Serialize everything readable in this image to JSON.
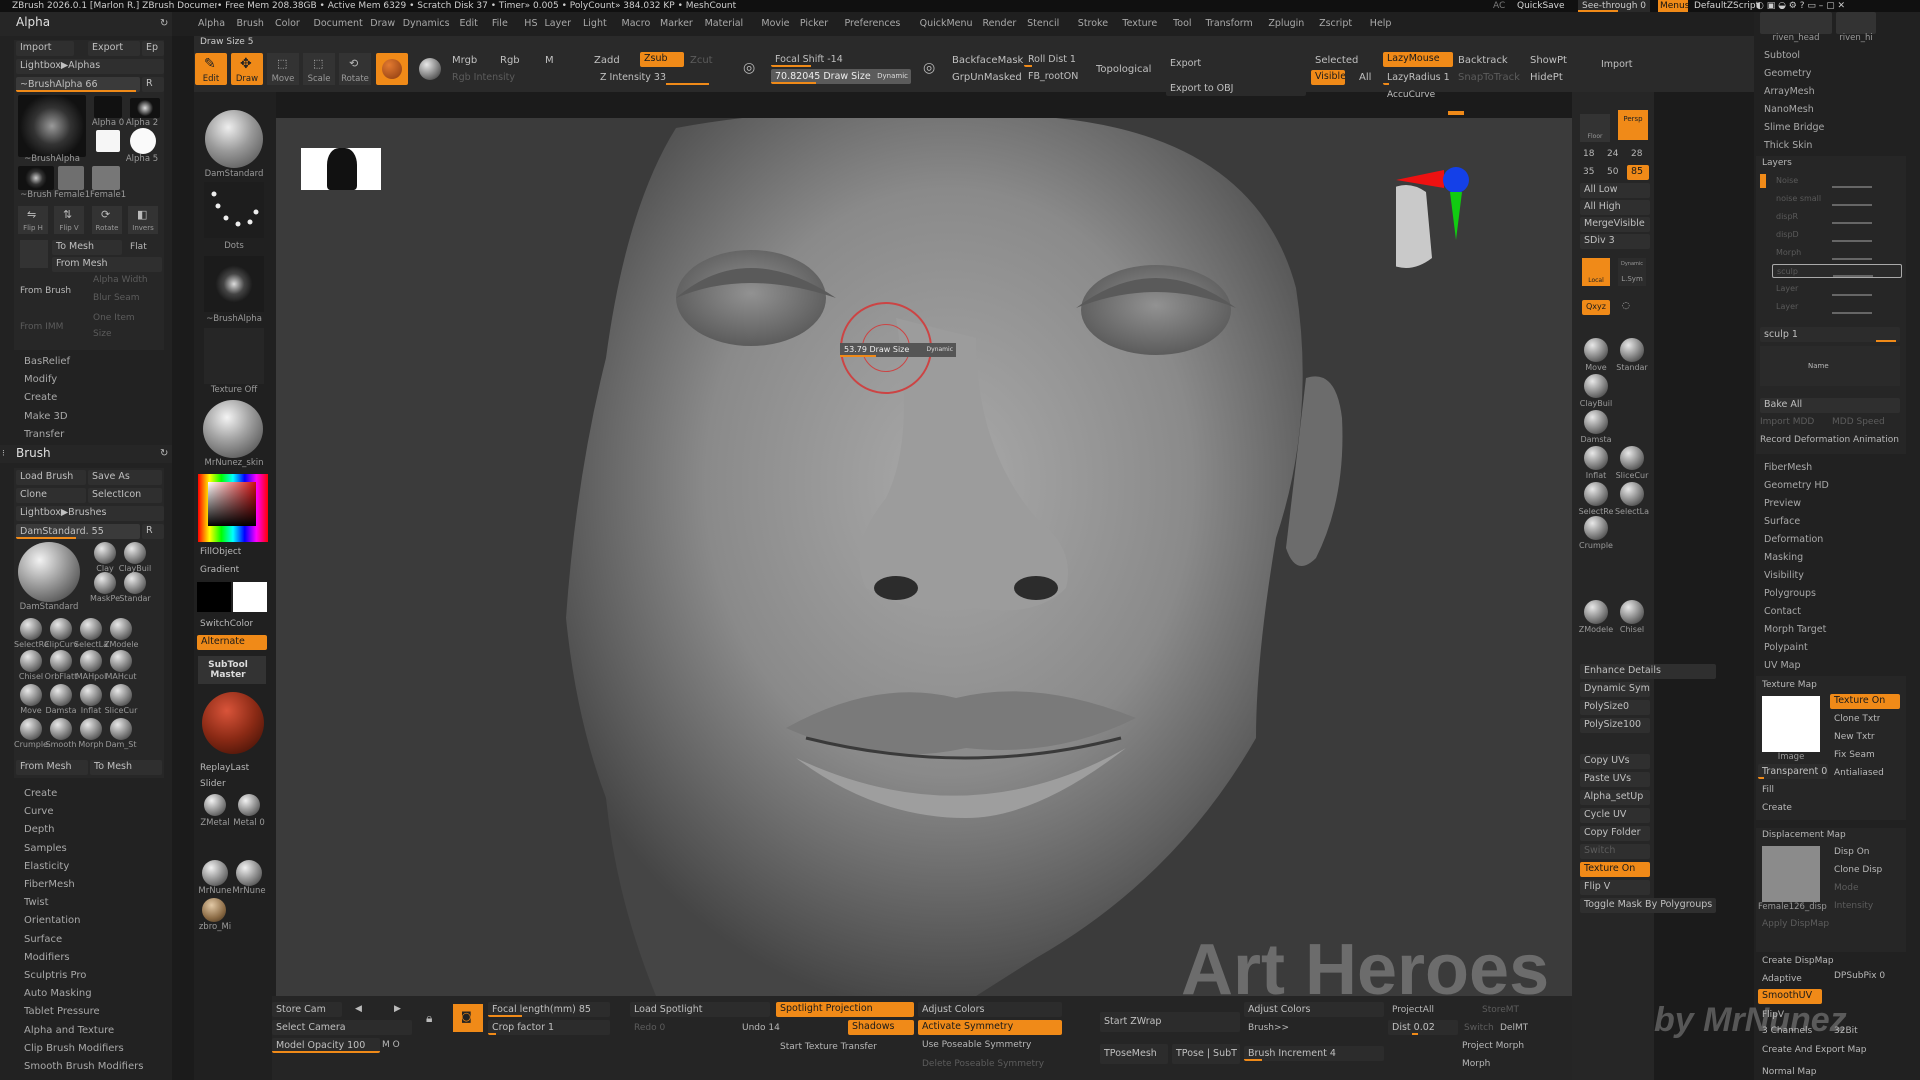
{
  "title_bar": {
    "app": "ZBrush 2026.0.1 [Marlon R.]  ZBrush Document",
    "stats": "• Free Mem 208.38GB • Active Mem 6329 • Scratch Disk 37 • Timer» 0.005 • PolyCount» 384.032 KP • MeshCount» 1",
    "ac": "AC",
    "quicksave": "QuickSave",
    "seethrough": "See-through  0",
    "menus": "Menus",
    "script": "DefaultZScript"
  },
  "menu_bar": [
    "Alpha",
    "Brush",
    "Color",
    "Document",
    "Draw",
    "Dynamics",
    "Edit",
    "File",
    "HS",
    "Layer",
    "Light",
    "Macro",
    "Marker",
    "Material",
    "Movie",
    "Picker",
    "Preferences",
    "QuickMenu",
    "Render",
    "Stencil",
    "Stroke",
    "Texture",
    "Tool",
    "Transform",
    "Zplugin",
    "Zscript",
    "Help"
  ],
  "shelf": {
    "draw_size_label": "Draw Size 5",
    "edit": "Edit",
    "draw": "Draw",
    "move": "Move",
    "scale": "Scale",
    "rotate": "Rotate",
    "mrgb": "Mrgb",
    "rgb": "Rgb",
    "m": "M",
    "rgb_intensity": "Rgb Intensity",
    "zadd": "Zadd",
    "zsub": "Zsub",
    "zcut": "Zcut",
    "z_intensity": "Z Intensity 33",
    "focal_shift": "Focal Shift -14",
    "draw_size": "70.82045 Draw Size",
    "dynamic": "Dynamic",
    "backface": "BackfaceMask",
    "grpunmasked": "GrpUnMasked",
    "rolldist": "Roll Dist 1",
    "fbroot": "FB_rootON",
    "topological": "Topological",
    "export": "Export",
    "export_obj": "Export to OBJ",
    "selected": "Selected",
    "visible": "Visible",
    "all": "All",
    "lazymouse": "LazyMouse",
    "lazyradius": "LazyRadius 1",
    "accucurve": "AccuCurve",
    "backtrack": "Backtrack",
    "snaptotrack": "SnapToTrack",
    "showpt": "ShowPt",
    "hidept": "HidePt",
    "import": "Import"
  },
  "left_tray": {
    "alpha_header": "Alpha",
    "import": "Import",
    "export": "Export",
    "ep": "Ep",
    "lightbox_alphas": "Lightbox▶Alphas",
    "brushalpha_slider": "~BrushAlpha  66",
    "r": "R",
    "alpha_names": [
      "~BrushAlpha",
      "Alpha 0",
      "Alpha 2",
      "Alpha 5",
      "~Brush",
      "Female1",
      "Female1"
    ],
    "flipH": "Flip H",
    "flipV": "Flip V",
    "rotate": "Rotate",
    "invers": "Invers",
    "to_mesh": "To Mesh",
    "flat": "Flat",
    "from_mesh": "From Mesh",
    "from_brush": "From Brush",
    "alpha_width": "Alpha Width",
    "blur_seam": "Blur Seam",
    "one_item": "One Item",
    "size": "Size",
    "from_img": "From IMM",
    "sections1": [
      "BasRelief",
      "Modify",
      "Create",
      "Make 3D",
      "Transfer"
    ],
    "brush_header": "Brush",
    "load_brush": "Load Brush",
    "save_as": "Save As",
    "clone": "Clone",
    "selecticon": "SelectIcon",
    "lightbox_brushes": "Lightbox▶Brushes",
    "damstandard_slider": "DamStandard. 55",
    "brush_grid": [
      "DamStandard",
      "Clay",
      "ClayBuil",
      "MaskPe",
      "Standar",
      "SelectRe",
      "ClipCurv",
      "SelectLa",
      "ZModele",
      "Chisel",
      "OrbFlatt",
      "MAHpol",
      "MAHcut",
      "Move",
      "Damsta",
      "Inflat",
      "SliceCur",
      "Crumple",
      "Smooth",
      "Morph",
      "Dam_St"
    ],
    "from_mesh2": "From Mesh",
    "to_mesh2": "To Mesh",
    "sections2": [
      "Create",
      "Curve",
      "Depth",
      "Samples",
      "Elasticity",
      "FiberMesh",
      "Twist",
      "Orientation",
      "Surface",
      "Modifiers",
      "Sculptris Pro",
      "Auto Masking",
      "Tablet Pressure",
      "Alpha and Texture",
      "Clip Brush Modifiers",
      "Smooth Brush Modifiers"
    ]
  },
  "brush_column": {
    "damstandard": "DamStandard",
    "dots": "Dots",
    "brushalpha": "~BrushAlpha",
    "texture_off": "Texture Off",
    "material": "MrNunez_skin",
    "fillobject": "FillObject",
    "gradient": "Gradient",
    "switchcolor": "SwitchColor",
    "alternate": "Alternate",
    "subtool_master": "SubTool Master",
    "replaylast": "ReplayLast",
    "slider": "Slider",
    "zmetal": "ZMetal",
    "metal": "Metal 0",
    "mrnune1": "MrNune",
    "mrnune2": "MrNune",
    "zbro": "zbro_Mi"
  },
  "canvas": {
    "brush_cursor_label": "53.79 Draw Size",
    "dynamic": "Dynamic"
  },
  "bottom_bar": {
    "store_cam": "Store Cam",
    "select_camera": "Select Camera",
    "model_opacity": "Model Opacity 100",
    "mo": "M  O",
    "focal_length": "Focal length(mm) 85",
    "crop_factor": "Crop factor 1",
    "load_spotlight": "Load Spotlight",
    "redo": "Redo 0",
    "undo": "Undo 14",
    "spotlight_proj": "Spotlight Projection",
    "shadows": "Shadows",
    "start_tex": "Start Texture Transfer",
    "adjust_colors": "Adjust Colors",
    "activate_sym": "Activate Symmetry",
    "poseable": "Use Poseable Symmetry",
    "del_poseable": "Delete Poseable Symmetry",
    "start_zwrap": "Start ZWrap",
    "tposemesh": "TPoseMesh",
    "tpose_subt": "TPose | SubT",
    "adjust_colors2": "Adjust Colors",
    "brush_gt": "Brush>>",
    "brush_increment": "Brush Increment 4",
    "projectall": "ProjectAll",
    "dist": "Dist 0.02",
    "storemt": "StoreMT",
    "switch": "Switch",
    "delmt": "DelMT",
    "project_morph": "Project Morph",
    "morph": "Morph"
  },
  "right_shelf": {
    "persp": "Persp",
    "floor": "Floor",
    "n18": "18",
    "n24": "24",
    "n28": "28",
    "n35": "35",
    "n50": "50",
    "n85": "85",
    "all_low": "All Low",
    "all_high": "All High",
    "mergevisible": "MergeVisible",
    "sdiv": "SDiv 3",
    "local": "Local",
    "lsym": "L.Sym",
    "dynamic": "Dynamic",
    "xyz": "Qxyz",
    "brushes": [
      "Move",
      "Standar",
      "ClayBuil",
      "Damsta",
      "Inflat",
      "SliceCur",
      "SelectRe",
      "SelectLa",
      "Crumple",
      "ZModele",
      "Chisel"
    ],
    "enhance": "Enhance Details",
    "dyn_sym": "Dynamic Sym",
    "polysize0": "PolySize0",
    "polysize100": "PolySize100",
    "copy_uvs": "Copy UVs",
    "paste_uvs": "Paste UVs",
    "alpha_setup": "Alpha_setUp",
    "cycle_uv": "Cycle UV",
    "copy_folder": "Copy Folder",
    "switch": "Switch",
    "texture_on": "Texture On",
    "flip_v": "Flip V",
    "toggle_mask": "Toggle Mask By Polygroups"
  },
  "right_tray": {
    "subtool_thumbs": [
      "riven_head",
      "riven_hi"
    ],
    "top_items": [
      "Subtool",
      "Geometry",
      "ArrayMesh",
      "NanoMesh",
      "Slime Bridge",
      "Thick Skin"
    ],
    "layers_header": "Layers",
    "layer_names": [
      "Noise",
      "noise small",
      "dispR",
      "dispD",
      "Morph",
      "sculp",
      "Layer",
      "Layer"
    ],
    "sculp1": "sculp 1",
    "name": "Name",
    "bake_all": "Bake All",
    "import_mdd": "Import MDD",
    "mdd_speed": "MDD Speed",
    "record": "Record Deformation Animation",
    "mid_items": [
      "FiberMesh",
      "Geometry HD",
      "Preview",
      "Surface",
      "Deformation",
      "Masking",
      "Visibility",
      "Polygroups",
      "Contact",
      "Morph Target",
      "Polypaint",
      "UV Map"
    ],
    "texture_map": "Texture Map",
    "texture_on": "Texture On",
    "clone_txtr": "Clone Txtr",
    "new_txtr": "New Txtr",
    "fix_seam": "Fix Seam",
    "antialiased": "Antialiased",
    "image": "Image",
    "transparent": "Transparent 0",
    "fill": "Fill",
    "create": "Create",
    "displacement_map": "Displacement Map",
    "disp_on": "Disp On",
    "clone_disp": "Clone Disp",
    "mode": "Mode",
    "intensity": "Intensity",
    "female_disp": "Female126_disp",
    "apply_dispmap": "Apply DispMap",
    "create_dispmap": "Create DispMap",
    "adaptive": "Adaptive",
    "dpsubpix": "DPSubPix 0",
    "smoothuv": "SmoothUV",
    "flipv": "FlipV",
    "channels": "3 Channels",
    "bit32": "32Bit",
    "create_export": "Create And Export Map",
    "normal_map": "Normal Map"
  },
  "watermark": {
    "line1": "Art Heroes",
    "line2": "by MrNunez"
  },
  "colors": {
    "accent": "#f08a18",
    "bg": "#1b1b1b",
    "panel": "#2f2f2f",
    "canvas": "#3d3d3d",
    "skin": "#8d8d8d"
  }
}
